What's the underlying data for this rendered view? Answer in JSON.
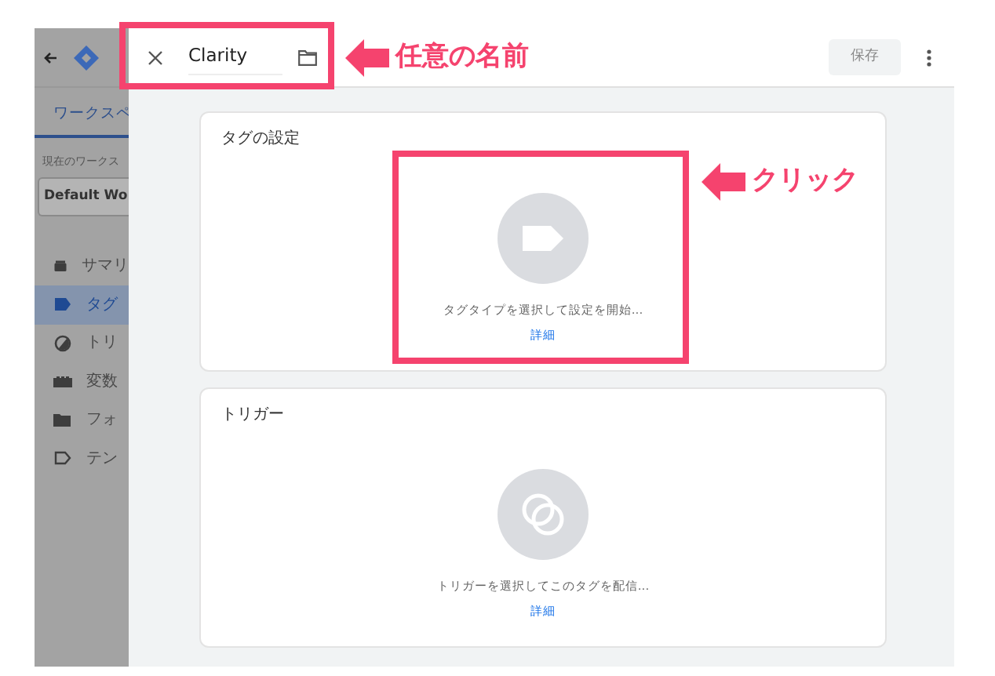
{
  "sidebar": {
    "tab": "ワークスペ",
    "workspace_label": "現在のワークス",
    "workspace": "Default Wo",
    "items": [
      {
        "label": "サマリ",
        "kind": "summary",
        "selected": false
      },
      {
        "label": "タグ",
        "kind": "tag",
        "selected": true
      },
      {
        "label": "トリ",
        "kind": "trigger",
        "selected": false
      },
      {
        "label": "変数",
        "kind": "variable",
        "selected": false
      },
      {
        "label": "フォ",
        "kind": "folder",
        "selected": false
      },
      {
        "label": "テン",
        "kind": "template",
        "selected": false
      }
    ]
  },
  "editor": {
    "name": "Clarity",
    "save": "保存",
    "cards": [
      {
        "title": "タグの設定",
        "kind": "tag",
        "prompt": "タグタイプを選択して設定を開始...",
        "link": "詳細"
      },
      {
        "title": "トリガー",
        "kind": "trigger",
        "prompt": "トリガーを選択してこのタグを配信...",
        "link": "詳細"
      }
    ]
  },
  "annotations": [
    {
      "text": "任意の名前"
    },
    {
      "text": "クリック"
    }
  ]
}
